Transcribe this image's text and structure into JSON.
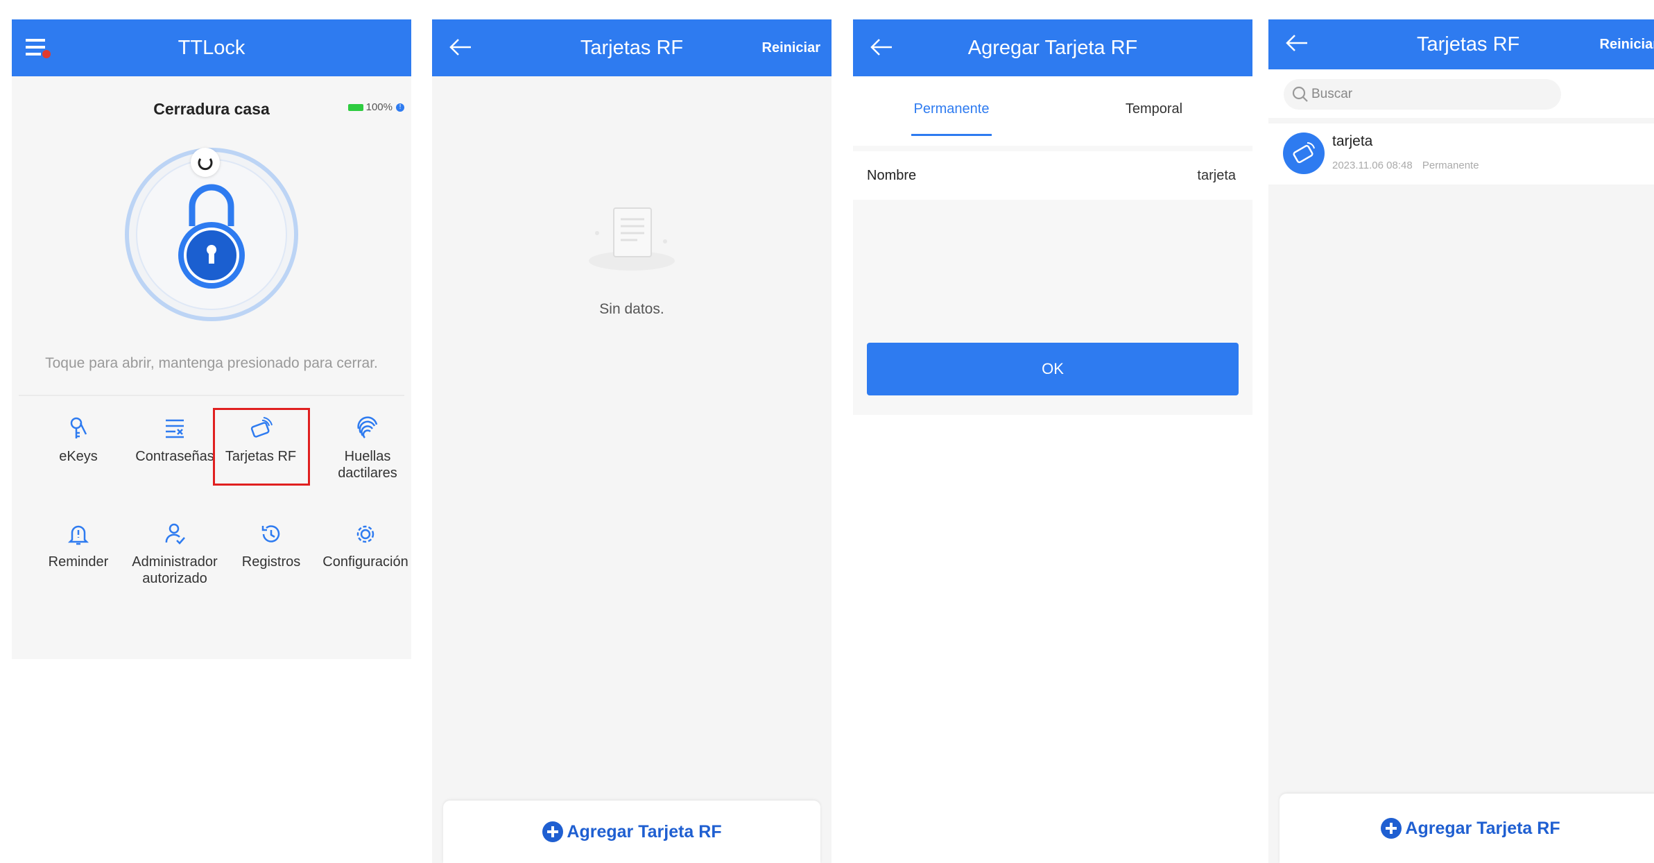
{
  "colors": {
    "brand": "#2e7bf0",
    "highlight": "#e02020",
    "battery": "#2ecc40"
  },
  "panel1": {
    "title": "TTLock",
    "lock_name": "Cerradura casa",
    "battery": "100%",
    "hint": "Toque para abrir, mantenga presionado para cerrar.",
    "menu": [
      {
        "label": "eKeys",
        "icon": "key-icon"
      },
      {
        "label": "Contraseñas",
        "icon": "password-list-icon"
      },
      {
        "label": "Tarjetas RF",
        "icon": "rf-card-icon",
        "highlighted": true
      },
      {
        "label": "Huellas dactilares",
        "icon": "fingerprint-icon"
      },
      {
        "label": "Reminder",
        "icon": "bell-icon"
      },
      {
        "label": "Administrador autorizado",
        "icon": "admin-user-icon"
      },
      {
        "label": "Registros",
        "icon": "history-icon"
      },
      {
        "label": "Configuración",
        "icon": "gear-icon"
      }
    ]
  },
  "panel2": {
    "title": "Tarjetas RF",
    "reset": "Reiniciar",
    "empty_text": "Sin datos.",
    "add_button": "Agregar Tarjeta RF"
  },
  "panel3": {
    "title": "Agregar Tarjeta RF",
    "tabs": [
      {
        "label": "Permanente",
        "active": true
      },
      {
        "label": "Temporal",
        "active": false
      }
    ],
    "field_label": "Nombre",
    "field_value": "tarjeta",
    "ok": "OK"
  },
  "panel4": {
    "title": "Tarjetas RF",
    "reset": "Reiniciar",
    "search_placeholder": "Buscar",
    "card": {
      "name": "tarjeta",
      "date": "2023.11.06 08:48",
      "type": "Permanente"
    },
    "add_button": "Agregar Tarjeta RF"
  }
}
